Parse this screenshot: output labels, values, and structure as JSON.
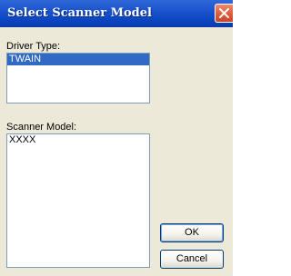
{
  "dialog": {
    "title": "Select Scanner Model",
    "close_icon": "close-icon",
    "close_color": "#e05a3a"
  },
  "driver_type": {
    "label": "Driver Type:",
    "items": [
      "TWAIN"
    ],
    "selected": "TWAIN"
  },
  "scanner_model": {
    "label": "Scanner Model:",
    "items": [
      "XXXX"
    ]
  },
  "buttons": {
    "ok_label": "OK",
    "cancel_label": "Cancel"
  },
  "colors": {
    "title_bar": "#1d56cf",
    "selection": "#316ac5",
    "dialog_background": "#ece9d8"
  }
}
